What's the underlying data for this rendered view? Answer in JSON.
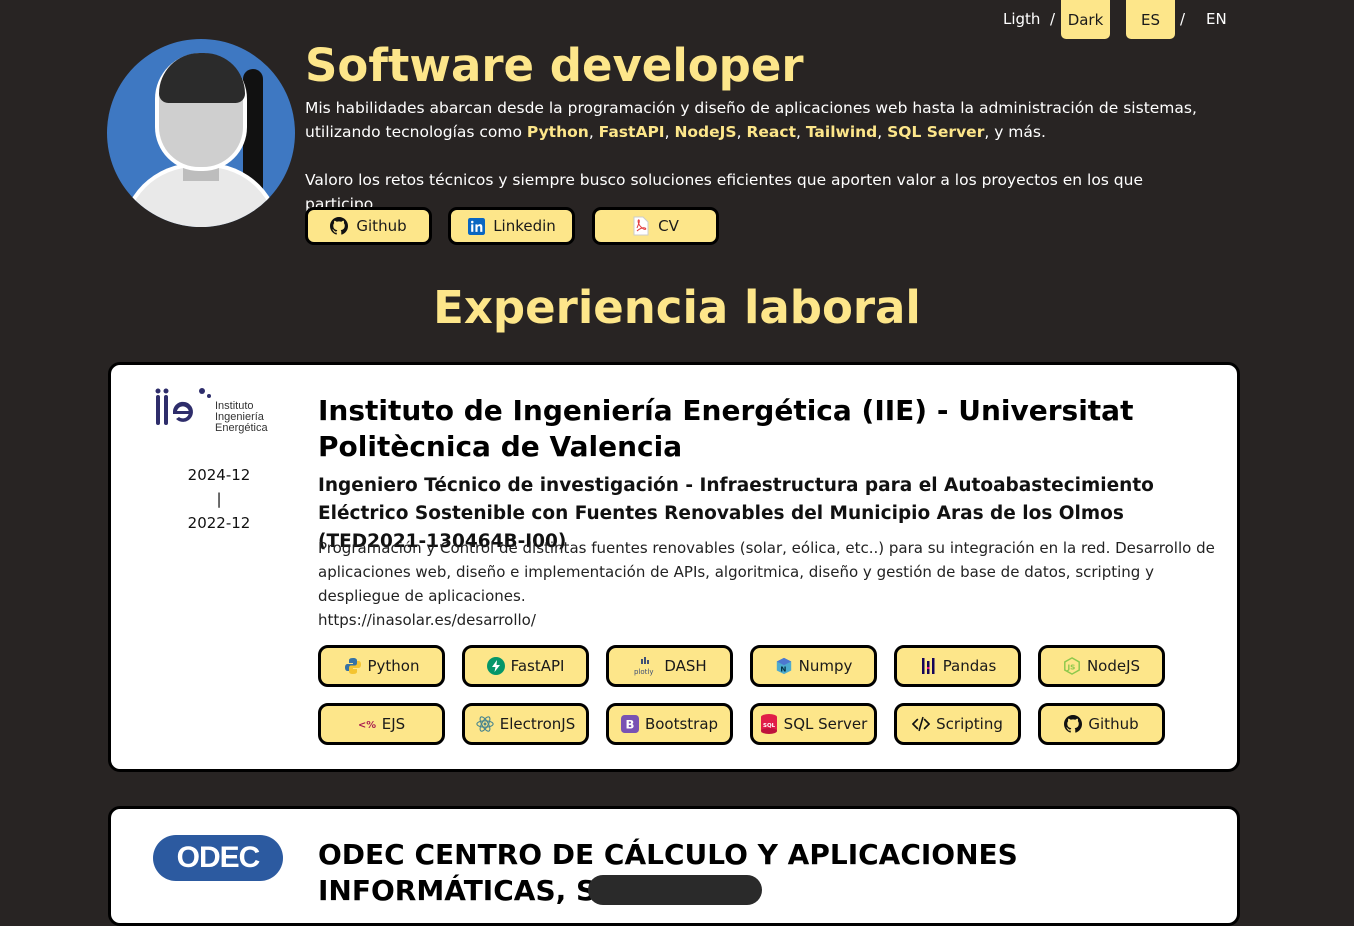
{
  "topbar": {
    "theme_light": "Ligth",
    "theme_sep": "/",
    "theme_dark": "Dark",
    "lang_es": "ES",
    "lang_sep": "/",
    "lang_en": "EN"
  },
  "profile": {
    "title": "Software developer",
    "intro_1_start": "Mis habilidades abarcan desde la programación y diseño de aplicaciones web hasta la administración de sistemas, utilizando tecnologías como ",
    "tech": [
      "Python",
      "FastAPI",
      "NodeJS",
      "React",
      "Tailwind",
      "SQL Server"
    ],
    "comma": ", ",
    "intro_1_end": ", y más.",
    "intro_2": "Valoro los retos técnicos y siempre busco soluciones eficientes que aporten valor a los proyectos en los que participo.",
    "links": {
      "github": "Github",
      "linkedin": "Linkedin",
      "cv": "CV"
    }
  },
  "section_title": "Experiencia laboral",
  "experience": [
    {
      "logo_lines": [
        "Instituto",
        "Ingeniería",
        "Energética"
      ],
      "logo_mark": "iie",
      "date_end": "2024-12",
      "date_sep": "|",
      "date_start": "2022-12",
      "company": "Instituto de Ingeniería Energética (IIE) - Universitat Politècnica de Valencia",
      "role": "Ingeniero Técnico de investigación - Infraestructura para el Autoabastecimiento Eléctrico Sostenible con Fuentes Renovables del Municipio Aras de los Olmos (TED2021-130464B-I00)",
      "description": "Programación y Control de distintas fuentes renovables (solar, eólica, etc..) para su integración en la red. Desarrollo de aplicaciones web, diseño e implementación de APIs, algoritmica, diseño y gestión de base de datos, scripting y despliegue de aplicaciones.",
      "url": "https://inasolar.es/desarrollo/",
      "skills": [
        "Python",
        "FastAPI",
        "DASH",
        "Numpy",
        "Pandas",
        "NodeJS",
        "EJS",
        "ElectronJS",
        "Bootstrap",
        "SQL Server",
        "Scripting",
        "Github"
      ]
    },
    {
      "logo_text": "ODEC",
      "company": "ODEC CENTRO DE CÁLCULO Y APLICACIONES INFORMÁTICAS, S.A."
    }
  ],
  "icons": {
    "github": "github-icon",
    "linkedin": "linkedin-icon",
    "cv": "pdf-icon",
    "python": "python-icon",
    "fastapi": "fastapi-icon",
    "dash": "plotly-icon",
    "numpy": "numpy-icon",
    "pandas": "pandas-icon",
    "nodejs": "nodejs-icon",
    "ejs": "ejs-icon",
    "electron": "electron-icon",
    "bootstrap": "bootstrap-icon",
    "sqlserver": "sql-server-icon",
    "scripting": "code-icon",
    "github2": "github-icon"
  },
  "colors": {
    "background": "#282423",
    "accent": "#fde68a",
    "card": "#ffffff",
    "odec": "#2c5aa0"
  }
}
